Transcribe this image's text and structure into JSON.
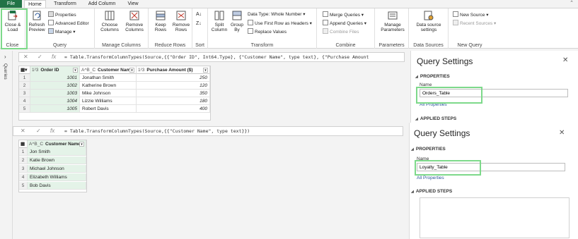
{
  "tabs": [
    "File",
    "Home",
    "Transform",
    "Add Column",
    "View"
  ],
  "ribbon": {
    "close": {
      "label": "Close & Load",
      "group": "Close"
    },
    "query": {
      "refresh": "Refresh Preview",
      "properties": "Properties",
      "advanced": "Advanced Editor",
      "manage": "Manage",
      "group": "Query"
    },
    "manage_columns": {
      "choose": "Choose Columns",
      "remove": "Remove Columns",
      "group": "Manage Columns"
    },
    "reduce_rows": {
      "keep": "Keep Rows",
      "remove": "Remove Rows",
      "group": "Reduce Rows"
    },
    "sort": {
      "group": "Sort"
    },
    "transform": {
      "split": "Split Column",
      "groupby": "Group By",
      "datatype": "Data Type: Whole Number",
      "firstrow": "Use First Row as Headers",
      "replace": "Replace Values",
      "group": "Transform"
    },
    "combine": {
      "merge": "Merge Queries",
      "append": "Append Queries",
      "files": "Combine Files",
      "group": "Combine"
    },
    "parameters": {
      "manage": "Manage Parameters",
      "group": "Parameters"
    },
    "data_sources": {
      "settings": "Data source settings",
      "group": "Data Sources"
    },
    "new_query": {
      "new_source": "New Source",
      "recent": "Recent Sources",
      "group": "New Query"
    }
  },
  "queries_pane_label": "Queries",
  "query1": {
    "formula": "= Table.TransformColumnTypes(Source,{{\"Order ID\", Int64.Type}, {\"Customer Name\", type text}, {\"Purchase Amount",
    "headers": [
      {
        "type": "1²3",
        "name": "Order ID"
      },
      {
        "type": "A^B_C",
        "name": "Customer Name"
      },
      {
        "type": "1²3",
        "name": "Purchase Amount ($)"
      }
    ],
    "rows": [
      {
        "n": "1",
        "id": "1001",
        "name": "Jonathan Smith",
        "amt": "250"
      },
      {
        "n": "2",
        "id": "1002",
        "name": "Katherine Brown",
        "amt": "120"
      },
      {
        "n": "3",
        "id": "1003",
        "name": "Mike Johnson",
        "amt": "350"
      },
      {
        "n": "4",
        "id": "1004",
        "name": "Lizzie Williams",
        "amt": "180"
      },
      {
        "n": "5",
        "id": "1005",
        "name": "Robert Davis",
        "amt": "400"
      }
    ]
  },
  "query2": {
    "formula": "= Table.TransformColumnTypes(Source,{{\"Customer Name\", type text}})",
    "headers": [
      {
        "type": "A^B_C",
        "name": "Customer Name"
      }
    ],
    "rows": [
      {
        "n": "1",
        "name": "Jon Smith"
      },
      {
        "n": "2",
        "name": "Katie Brown"
      },
      {
        "n": "3",
        "name": "Michael Johnson"
      },
      {
        "n": "4",
        "name": "Elizabeth Williams"
      },
      {
        "n": "5",
        "name": "Bob Davis"
      }
    ]
  },
  "settings1": {
    "title": "Query Settings",
    "properties": "PROPERTIES",
    "name_label": "Name",
    "name_value": "Orders_Table",
    "all_props": "All Properties",
    "applied": "APPLIED STEPS"
  },
  "settings2": {
    "title": "Query Settings",
    "properties": "PROPERTIES",
    "name_label": "Name",
    "name_value": "Loyalty_Table",
    "all_props": "All Properties",
    "applied": "APPLIED STEPS"
  },
  "colors": {
    "accent": "#217346",
    "highlight": "#7dd98a",
    "column_selected": "#e4f3e8"
  }
}
